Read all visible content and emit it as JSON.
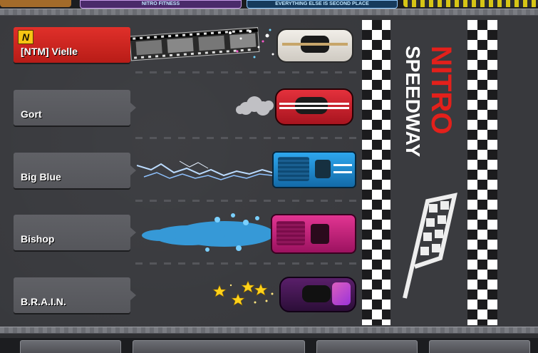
{
  "top_bar": {
    "banner_a_text": "NITRO FITNESS",
    "banner_b_text": "EVERYTHING ELSE IS SECOND PLACE",
    "colors": {
      "banner_a": "#4a2a6a",
      "banner_b": "#163a5c",
      "banner_c": "#2c2d30"
    }
  },
  "logo": {
    "line1": "NITRO",
    "line2": "SPEEDWAY",
    "colors": {
      "line1": "#e3201b",
      "line2": "#ffffff"
    }
  },
  "racers": [
    {
      "name": "[NTM] Vielle",
      "badge": "N",
      "highlight": true,
      "car_color": "#e9e5df",
      "trail": "filmstrip-sparkle"
    },
    {
      "name": "Gort",
      "badge": "",
      "highlight": false,
      "car_color": "#cc1f2b",
      "trail": "smoke"
    },
    {
      "name": "Big Blue",
      "badge": "",
      "highlight": false,
      "car_color": "#1c8fd8",
      "trail": "lightning"
    },
    {
      "name": "Bishop",
      "badge": "",
      "highlight": false,
      "car_color": "#c41f7a",
      "trail": "blue-flame"
    },
    {
      "name": "B.R.A.I.N.",
      "badge": "",
      "highlight": false,
      "car_color": "#6a2a7a",
      "trail": "stars"
    }
  ],
  "icons": {
    "team_badge": "team-badge-icon",
    "finish": "checkered-flag-icon"
  },
  "colors": {
    "track": "#38393d",
    "plate_grey": "#5b5c61",
    "plate_red": "#d42620"
  }
}
